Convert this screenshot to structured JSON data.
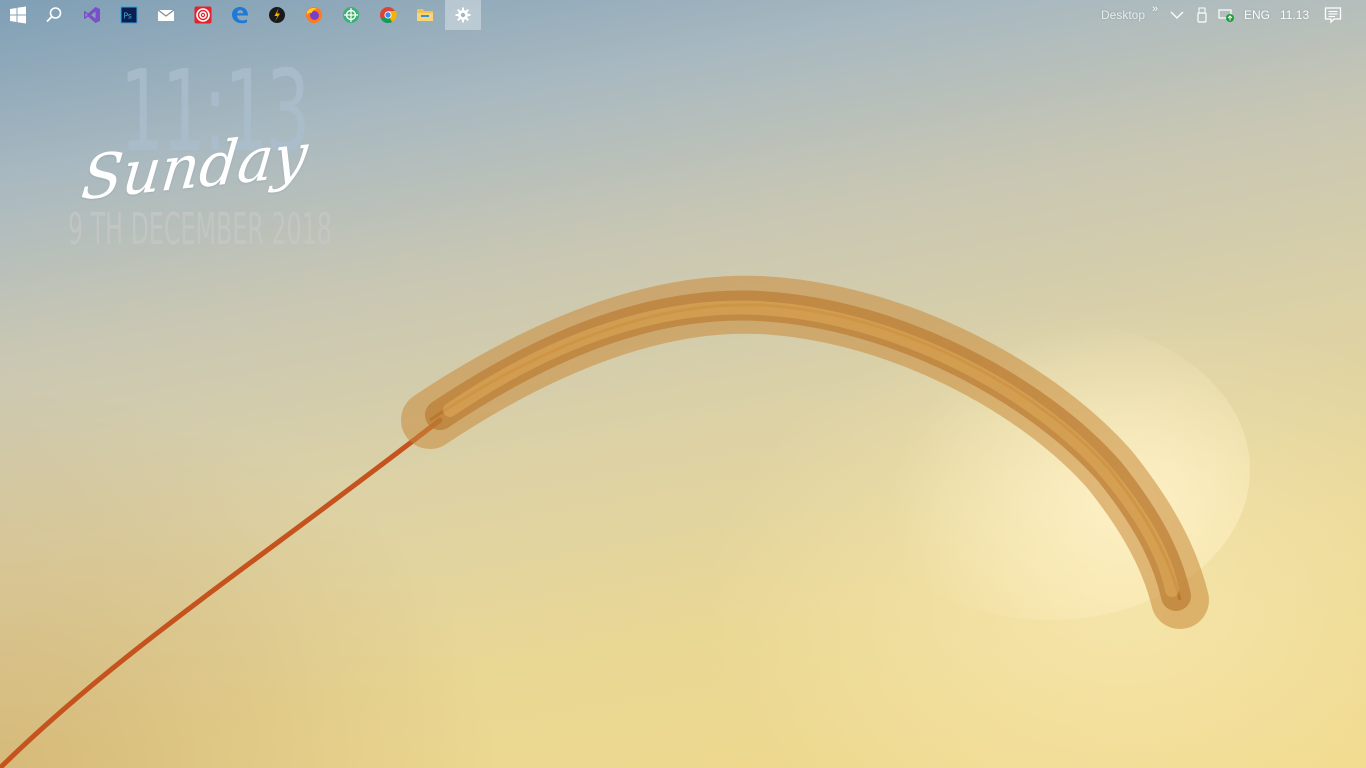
{
  "taskbar": {
    "pinned": [
      {
        "name": "start-button",
        "icon": "windows-logo-icon"
      },
      {
        "name": "search-button",
        "icon": "search-icon"
      },
      {
        "name": "visual-studio-button",
        "icon": "visual-studio-icon"
      },
      {
        "name": "photoshop-button",
        "icon": "photoshop-icon",
        "label": "Ps"
      },
      {
        "name": "mail-button",
        "icon": "mail-icon"
      },
      {
        "name": "target-app-button",
        "icon": "target-icon"
      },
      {
        "name": "edge-button",
        "icon": "edge-icon"
      },
      {
        "name": "winamp-button",
        "icon": "winamp-icon"
      },
      {
        "name": "firefox-button",
        "icon": "firefox-icon"
      },
      {
        "name": "network-app-button",
        "icon": "globe-app-icon"
      },
      {
        "name": "chrome-button",
        "icon": "chrome-icon"
      },
      {
        "name": "file-explorer-button",
        "icon": "folder-icon"
      },
      {
        "name": "settings-button",
        "icon": "gear-icon"
      }
    ],
    "tray": {
      "desktop_label": "Desktop",
      "overflow_glyph": "»",
      "language": "ENG",
      "time": "11.13"
    }
  },
  "widget": {
    "time": "11:13",
    "day": "Sunday",
    "date": "9 TH DECEMBER 2018"
  },
  "colors": {
    "widget_time": "#aabecd",
    "widget_day": "#ffffff",
    "stem": "#c4531d",
    "spike": "#b8782e"
  }
}
